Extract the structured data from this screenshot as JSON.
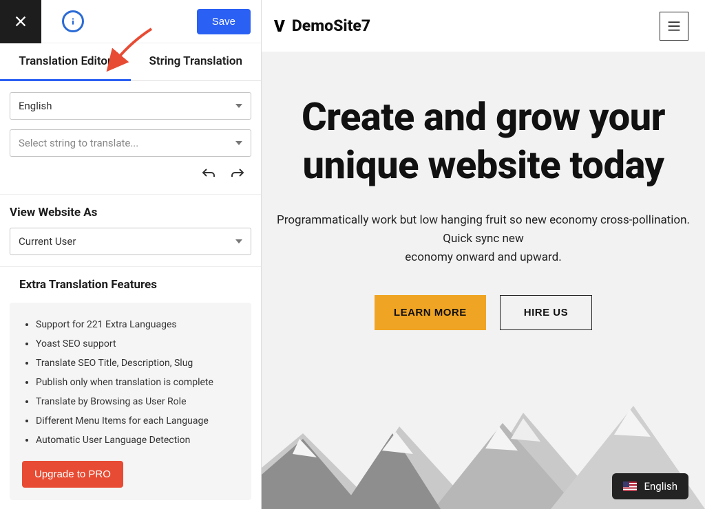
{
  "topbar": {
    "save_label": "Save"
  },
  "tabs": {
    "editor": "Translation Editor",
    "string": "String Translation"
  },
  "language_select": {
    "value": "English"
  },
  "string_select": {
    "placeholder": "Select string to translate..."
  },
  "view_as": {
    "heading": "View Website As",
    "value": "Current User"
  },
  "extras": {
    "heading": "Extra Translation Features",
    "items": [
      "Support for 221 Extra Languages",
      "Yoast SEO support",
      "Translate SEO Title, Description, Slug",
      "Publish only when translation is complete",
      "Translate by Browsing as User Role",
      "Different Menu Items for each Language",
      "Automatic User Language Detection"
    ],
    "upgrade_label": "Upgrade to PRO"
  },
  "preview": {
    "brand": "DemoSite7",
    "hero_title": "Create and grow your unique website today",
    "hero_desc_line1": "Programmatically work but low hanging fruit so new economy cross-pollination. Quick sync new",
    "hero_desc_line2": "economy onward and upward.",
    "learn_more": "LEARN MORE",
    "hire_us": "HIRE US",
    "lang_label": "English"
  }
}
